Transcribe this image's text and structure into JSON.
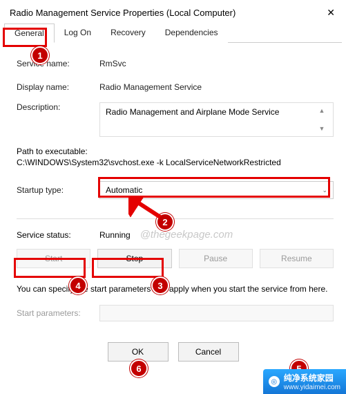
{
  "window": {
    "title": "Radio Management Service Properties (Local Computer)"
  },
  "tabs": {
    "general": "General",
    "logon": "Log On",
    "recovery": "Recovery",
    "dependencies": "Dependencies"
  },
  "labels": {
    "service_name": "Service name:",
    "display_name": "Display name:",
    "description": "Description:",
    "path_to_exe": "Path to executable:",
    "startup_type": "Startup type:",
    "service_status": "Service status:",
    "start_parameters": "Start parameters:"
  },
  "values": {
    "service_name": "RmSvc",
    "display_name": "Radio Management Service",
    "description": "Radio Management and Airplane Mode Service",
    "path": "C:\\WINDOWS\\System32\\svchost.exe -k LocalServiceNetworkRestricted",
    "startup_type": "Automatic",
    "service_status": "Running"
  },
  "buttons": {
    "start": "Start",
    "stop": "Stop",
    "pause": "Pause",
    "resume": "Resume",
    "ok": "OK",
    "cancel": "Cancel"
  },
  "note": "You can specify the start parameters that apply when you start the service from here.",
  "watermark": "@thegeekpage.com",
  "markers": {
    "m1": "1",
    "m2": "2",
    "m3": "3",
    "m4": "4",
    "m5": "5",
    "m6": "6"
  },
  "banner": {
    "title": "纯净系统家园",
    "url": "www.yidaimei.com"
  }
}
